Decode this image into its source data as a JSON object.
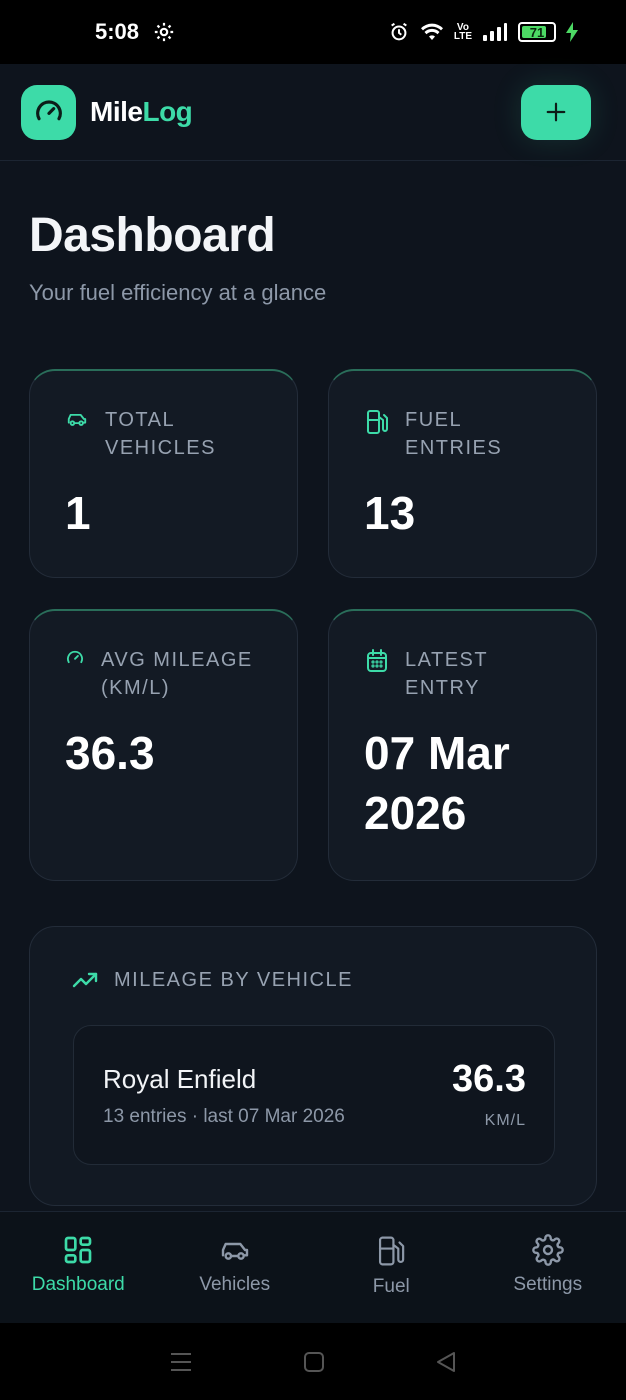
{
  "status_bar": {
    "time": "5:08",
    "volte_top": "Vo",
    "volte_bottom": "LTE",
    "battery": "71"
  },
  "header": {
    "brand_part1": "Mile",
    "brand_part2": "Log"
  },
  "page": {
    "title": "Dashboard",
    "subtitle": "Your fuel efficiency at a glance"
  },
  "stats": [
    {
      "label_line1": "TOTAL",
      "label_line2": "VEHICLES",
      "value": "1",
      "icon": "car-icon"
    },
    {
      "label_line1": "FUEL",
      "label_line2": "ENTRIES",
      "value": "13",
      "icon": "fuel-pump-icon"
    },
    {
      "label_line1": "AVG MILEAGE",
      "label_line2": "(KM/L)",
      "value": "36.3",
      "icon": "gauge-icon"
    },
    {
      "label_line1": "LATEST",
      "label_line2": "ENTRY",
      "value_line1": "07 Mar",
      "value_line2": "2026",
      "icon": "calendar-icon"
    }
  ],
  "mileage_section": {
    "title": "MILEAGE BY VEHICLE",
    "vehicles": [
      {
        "name": "Royal Enfield",
        "meta": "13 entries · last 07 Mar 2026",
        "value": "36.3",
        "unit": "KM/L"
      }
    ]
  },
  "nav": [
    {
      "label": "Dashboard",
      "active": true
    },
    {
      "label": "Vehicles",
      "active": false
    },
    {
      "label": "Fuel",
      "active": false
    },
    {
      "label": "Settings",
      "active": false
    }
  ],
  "colors": {
    "accent": "#3ddba8",
    "background": "#0e141d",
    "card": "#131a24",
    "muted": "#8d98a8"
  }
}
